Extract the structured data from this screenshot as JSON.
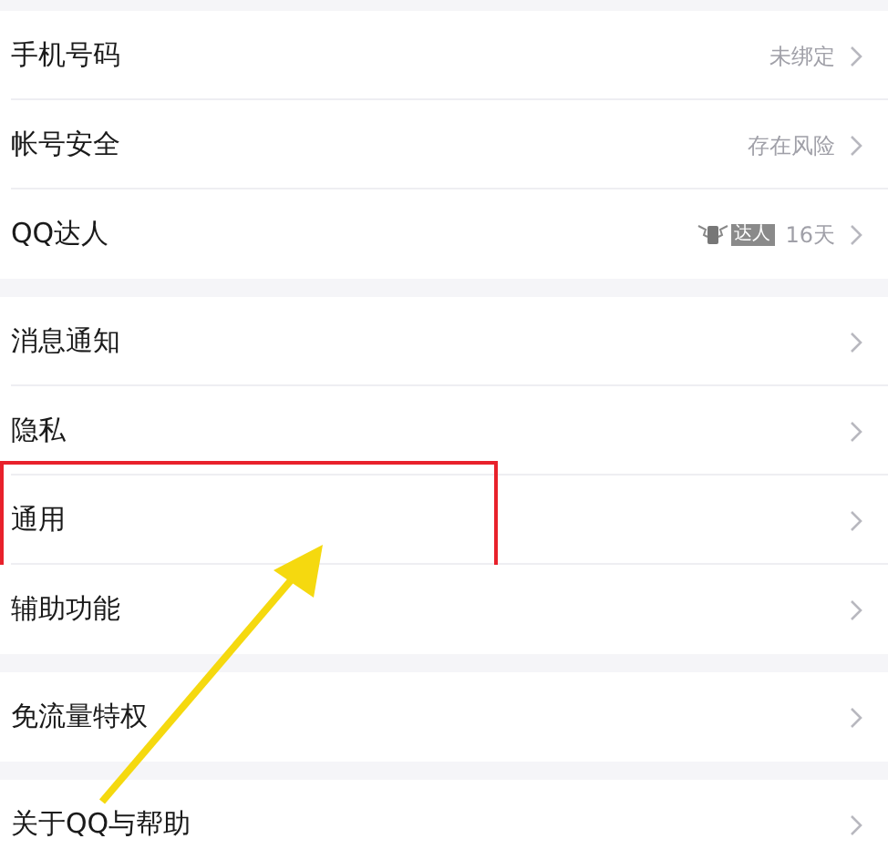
{
  "groups": [
    {
      "items": [
        {
          "label": "手机号码",
          "value": "未绑定",
          "highlighted": false
        },
        {
          "label": "帐号安全",
          "value": "存在风险",
          "highlighted": false
        },
        {
          "label": "QQ达人",
          "badge": "达人",
          "value": "16天",
          "highlighted": false
        }
      ]
    },
    {
      "items": [
        {
          "label": "消息通知",
          "highlighted": false
        },
        {
          "label": "隐私",
          "highlighted": false
        },
        {
          "label": "通用",
          "highlighted": true
        },
        {
          "label": "辅助功能",
          "highlighted": false
        }
      ]
    },
    {
      "items": [
        {
          "label": "免流量特权",
          "highlighted": false
        }
      ]
    },
    {
      "items": [
        {
          "label": "关于QQ与帮助",
          "highlighted": false
        }
      ]
    }
  ]
}
